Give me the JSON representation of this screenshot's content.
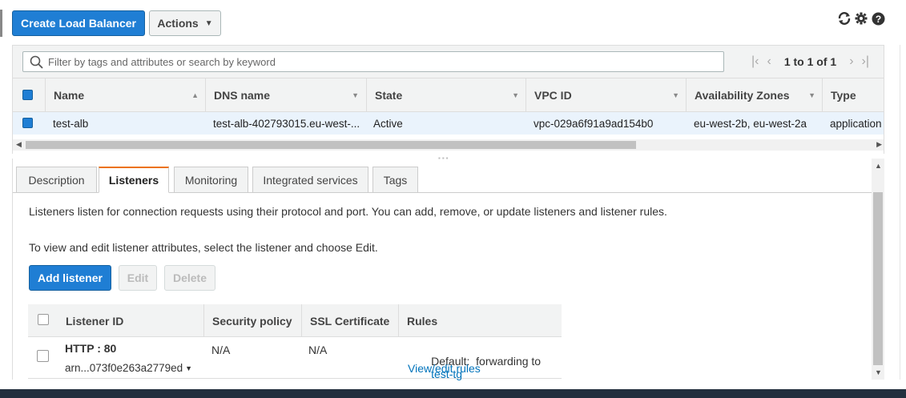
{
  "toolbar": {
    "create_label": "Create Load Balancer",
    "actions_label": "Actions"
  },
  "icons": {
    "refresh": "refresh-icon",
    "settings": "gear-icon",
    "help": "help-icon"
  },
  "search": {
    "placeholder": "Filter by tags and attributes or search by keyword"
  },
  "pagination": {
    "text": "1 to 1 of 1"
  },
  "table": {
    "columns": [
      "Name",
      "DNS name",
      "State",
      "VPC ID",
      "Availability Zones",
      "Type"
    ],
    "rows": [
      {
        "name": "test-alb",
        "dns": "test-alb-402793015.eu-west-...",
        "state": "Active",
        "vpc": "vpc-029a6f91a9ad154b0",
        "azs": "eu-west-2b, eu-west-2a",
        "type": "application"
      }
    ]
  },
  "tabs": [
    "Description",
    "Listeners",
    "Monitoring",
    "Integrated services",
    "Tags"
  ],
  "active_tab": "Listeners",
  "listeners": {
    "intro": "Listeners listen for connection requests using their protocol and port. You can add, remove, or update listeners and listener rules.",
    "edit_hint": "To view and edit listener attributes, select the listener and choose Edit.",
    "add_label": "Add listener",
    "edit_label": "Edit",
    "delete_label": "Delete",
    "columns": [
      "Listener ID",
      "Security policy",
      "SSL Certificate",
      "Rules"
    ],
    "rows": [
      {
        "id": "HTTP : 80",
        "arn": "arn...073f0e263a2779ed",
        "policy": "N/A",
        "cert": "N/A",
        "rule_prefix": "Default:  forwarding to",
        "rule_target": "test-tg",
        "rule_link": "View/edit rules"
      }
    ]
  },
  "colors": {
    "primary": "#1f7ed4",
    "accent_tab": "#ec7211",
    "link": "#0073bb",
    "selected_row": "#eaf3fc"
  }
}
